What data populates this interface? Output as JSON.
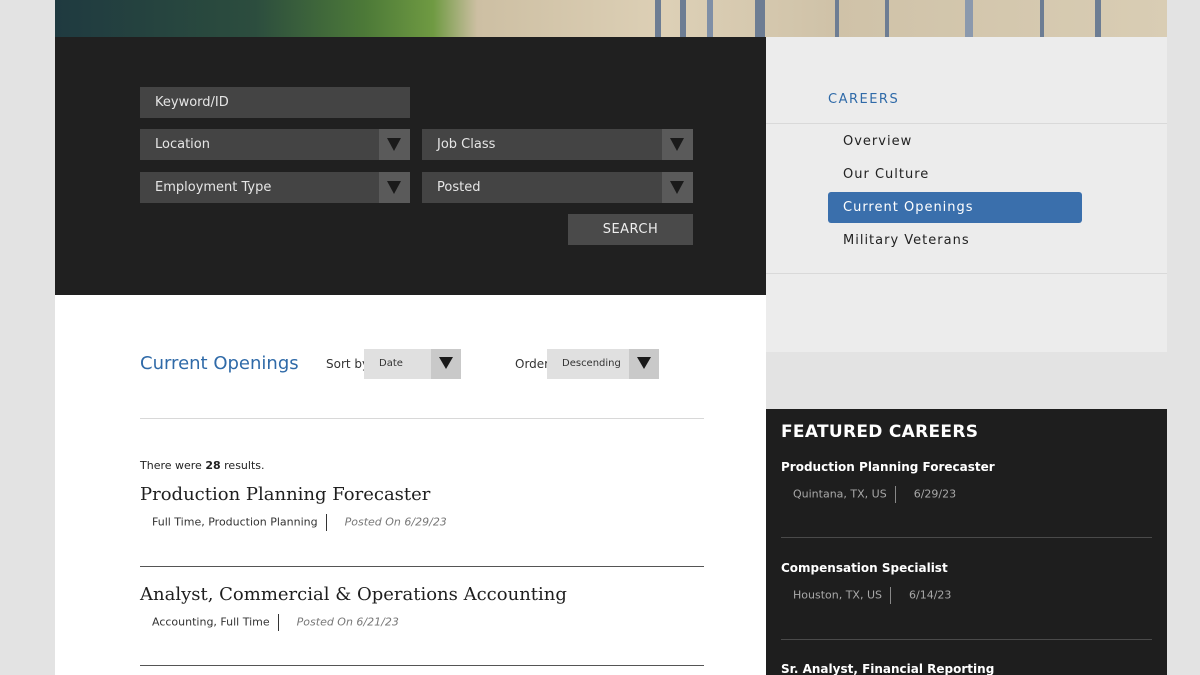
{
  "search": {
    "keyword_placeholder": "Keyword/ID",
    "location_label": "Location",
    "job_class_label": "Job Class",
    "employment_type_label": "Employment Type",
    "posted_label": "Posted",
    "search_button": "SEARCH"
  },
  "sidenav": {
    "heading": "CAREERS",
    "items": [
      {
        "label": "Overview"
      },
      {
        "label": "Our Culture"
      },
      {
        "label": "Current Openings"
      },
      {
        "label": "Military Veterans"
      }
    ]
  },
  "main": {
    "title": "Current Openings",
    "sort_by_label": "Sort by",
    "sort_by_value": "Date",
    "order_label": "Order",
    "order_value": "Descending",
    "results_prefix": "There were",
    "results_count": "28",
    "results_suffix": "results.",
    "jobs": [
      {
        "title": "Production Planning Forecaster",
        "tags": "Full Time, Production Planning",
        "posted": "Posted On 6/29/23"
      },
      {
        "title": "Analyst, Commercial & Operations Accounting",
        "tags": "Accounting, Full Time",
        "posted": "Posted On 6/21/23"
      }
    ]
  },
  "featured": {
    "heading": "FEATURED CAREERS",
    "jobs": [
      {
        "title": "Production Planning Forecaster",
        "location": "Quintana, TX, US",
        "date": "6/29/23"
      },
      {
        "title": "Compensation Specialist",
        "location": "Houston, TX, US",
        "date": "6/14/23"
      },
      {
        "title": "Sr. Analyst, Financial Reporting"
      }
    ]
  },
  "colors": {
    "accent": "#3a6fac",
    "link_blue": "#2f6aa8",
    "dark_panel": "#202020"
  }
}
